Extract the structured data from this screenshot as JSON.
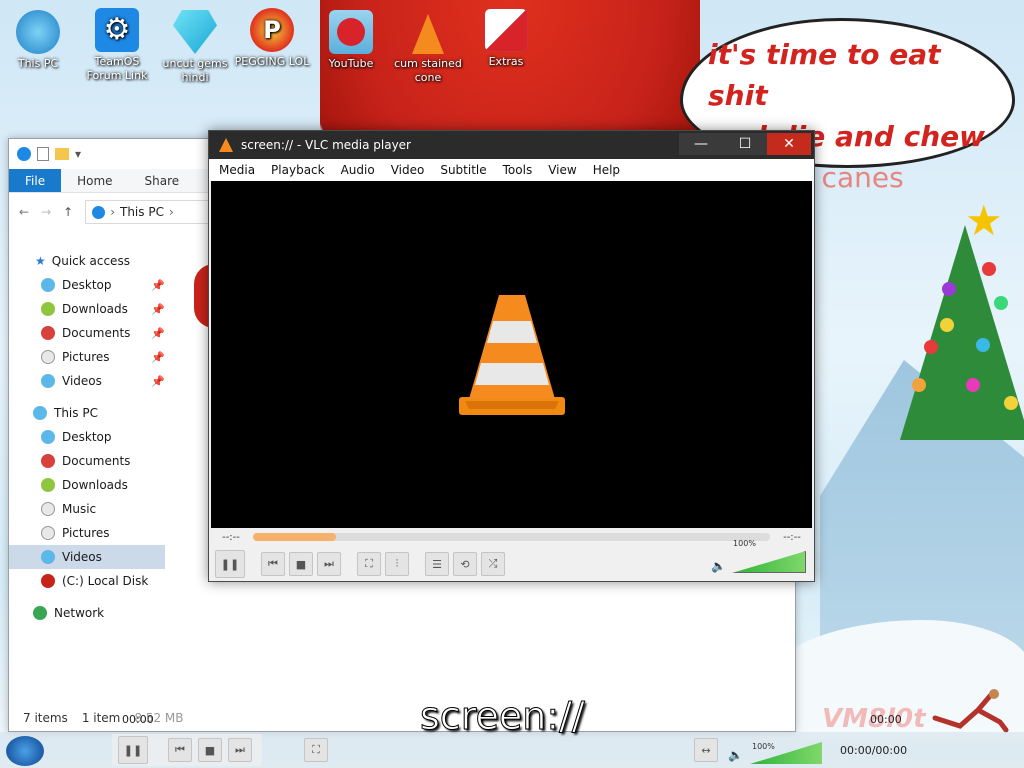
{
  "desktop": {
    "icons": [
      {
        "label": "This PC"
      },
      {
        "label": "TeamOS Forum Link"
      },
      {
        "label": "uncut gems hindi"
      },
      {
        "label": "PEGGING LOL"
      },
      {
        "label": "YouTube"
      },
      {
        "label": "cum stained cone"
      },
      {
        "label": "Extras"
      }
    ],
    "bubble_lines": [
      "it's time to eat shit",
      "and die and chew",
      "candy canes"
    ],
    "watermark": "VM8l0t",
    "overlay_title": "screen://"
  },
  "explorer": {
    "ribbon_tabs": [
      "File",
      "Home",
      "Share",
      "Vi"
    ],
    "address": "This PC",
    "nav": [
      {
        "label": "Quick access"
      },
      {
        "label": "Desktop"
      },
      {
        "label": "Downloads"
      },
      {
        "label": "Documents"
      },
      {
        "label": "Pictures"
      },
      {
        "label": "Videos"
      },
      {
        "label": "This PC"
      },
      {
        "label": "Desktop"
      },
      {
        "label": "Documents"
      },
      {
        "label": "Downloads"
      },
      {
        "label": "Music"
      },
      {
        "label": "Pictures"
      },
      {
        "label": "Videos"
      },
      {
        "label": "(C:) Local Disk"
      },
      {
        "label": "Network"
      }
    ],
    "status_items": "7 items",
    "status_selected": "1 item",
    "status_size": "8.52 MB"
  },
  "vlc": {
    "title": "screen:// - VLC media player",
    "menu": [
      "Media",
      "Playback",
      "Audio",
      "Video",
      "Subtitle",
      "Tools",
      "View",
      "Help"
    ],
    "time_left": "--:--",
    "time_right": "--:--",
    "seek_progress": 0.16,
    "volume_label": "100%",
    "volume_level": 1.0
  },
  "fullscreen_controller": {
    "time_left": "00:00",
    "time_right": "00:00",
    "time_total": "00:00/00:00",
    "volume_label": "100%"
  },
  "colors": {
    "accent_file_tab": "#1979ca",
    "vlc_orange": "#f58b1f",
    "close_red": "#c42b1c"
  }
}
